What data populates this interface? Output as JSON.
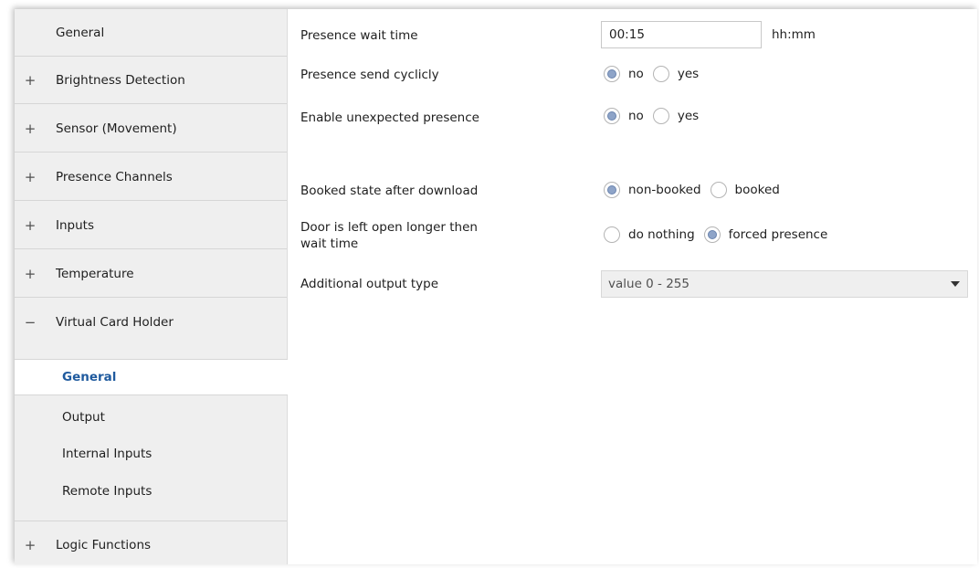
{
  "sidebar": {
    "items": [
      {
        "sign": "",
        "label": "General"
      },
      {
        "sign": "+",
        "label": "Brightness Detection"
      },
      {
        "sign": "+",
        "label": "Sensor (Movement)"
      },
      {
        "sign": "+",
        "label": "Presence Channels"
      },
      {
        "sign": "+",
        "label": "Inputs"
      },
      {
        "sign": "+",
        "label": "Temperature"
      },
      {
        "sign": "−",
        "label": "Virtual Card Holder"
      }
    ],
    "sub_items": [
      {
        "label": "General",
        "active": true
      },
      {
        "label": "Output"
      },
      {
        "label": "Internal Inputs"
      },
      {
        "label": "Remote Inputs"
      }
    ],
    "last_item": {
      "sign": "+",
      "label": "Logic Functions"
    }
  },
  "params": {
    "presence_wait_time": {
      "label": "Presence wait time",
      "value": "00:15",
      "unit": "hh:mm"
    },
    "presence_send_cyclicly": {
      "label": "Presence send cyclicly",
      "options": [
        "no",
        "yes"
      ],
      "selected": "no"
    },
    "enable_unexpected_presence": {
      "label": "Enable unexpected presence",
      "options": [
        "no",
        "yes"
      ],
      "selected": "no"
    },
    "booked_state": {
      "label": "Booked state after download",
      "options": [
        "non-booked",
        "booked"
      ],
      "selected": "non-booked"
    },
    "door_left_open": {
      "label_line1": "Door is left open longer then",
      "label_line2": "wait time",
      "options": [
        "do nothing",
        "forced presence"
      ],
      "selected": "forced presence"
    },
    "additional_output_type": {
      "label": "Additional output type",
      "value": "value 0 - 255"
    }
  }
}
